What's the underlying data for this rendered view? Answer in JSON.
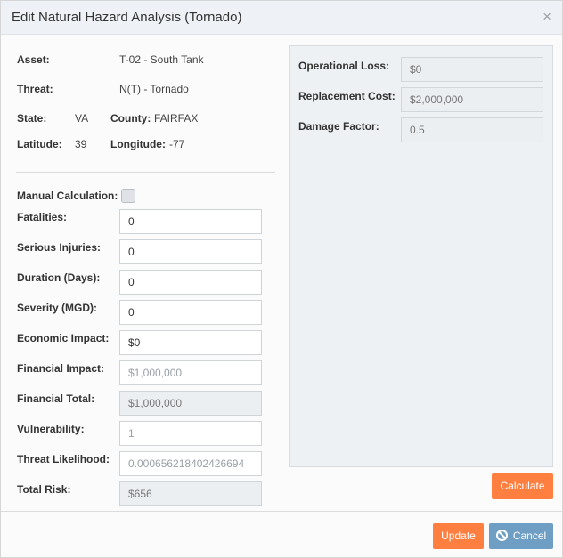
{
  "modal": {
    "title": "Edit Natural Hazard Analysis (Tornado)",
    "close_symbol": "×"
  },
  "info": {
    "asset_label": "Asset:",
    "asset_value": "T-02 - South Tank",
    "threat_label": "Threat:",
    "threat_value": "N(T) - Tornado",
    "state_label": "State:",
    "state_value": "VA",
    "county_label": "County:",
    "county_value": "FAIRFAX",
    "latitude_label": "Latitude:",
    "latitude_value": "39",
    "longitude_label": "Longitude:",
    "longitude_value": "-77"
  },
  "form": {
    "manual_calc_label": "Manual Calculation:",
    "manual_calc_checked": false,
    "fatalities_label": "Fatalities:",
    "fatalities_value": "0",
    "serious_injuries_label": "Serious Injuries:",
    "serious_injuries_value": "0",
    "duration_label": "Duration (Days):",
    "duration_value": "0",
    "severity_label": "Severity (MGD):",
    "severity_value": "0",
    "economic_impact_label": "Economic Impact:",
    "economic_impact_value": "$0",
    "financial_impact_label": "Financial Impact:",
    "financial_impact_value": "$1,000,000",
    "financial_total_label": "Financial Total:",
    "financial_total_value": "$1,000,000",
    "vulnerability_label": "Vulnerability:",
    "vulnerability_value": "1",
    "threat_likelihood_label": "Threat Likelihood:",
    "threat_likelihood_value": "0.000656218402426694",
    "total_risk_label": "Total Risk:",
    "total_risk_value": "$656"
  },
  "panel": {
    "operational_loss_label": "Operational Loss:",
    "operational_loss_value": "$0",
    "replacement_cost_label": "Replacement Cost:",
    "replacement_cost_value": "$2,000,000",
    "damage_factor_label": "Damage Factor:",
    "damage_factor_value": "0.5"
  },
  "buttons": {
    "calculate": "Calculate",
    "update": "Update",
    "cancel": "Cancel"
  },
  "colors": {
    "primary_orange": "#ff7f41",
    "cancel_blue": "#6e9ec4",
    "header_bg": "#eef2f6"
  },
  "icons": {
    "close": "close-icon",
    "cancel": "ban-icon"
  }
}
